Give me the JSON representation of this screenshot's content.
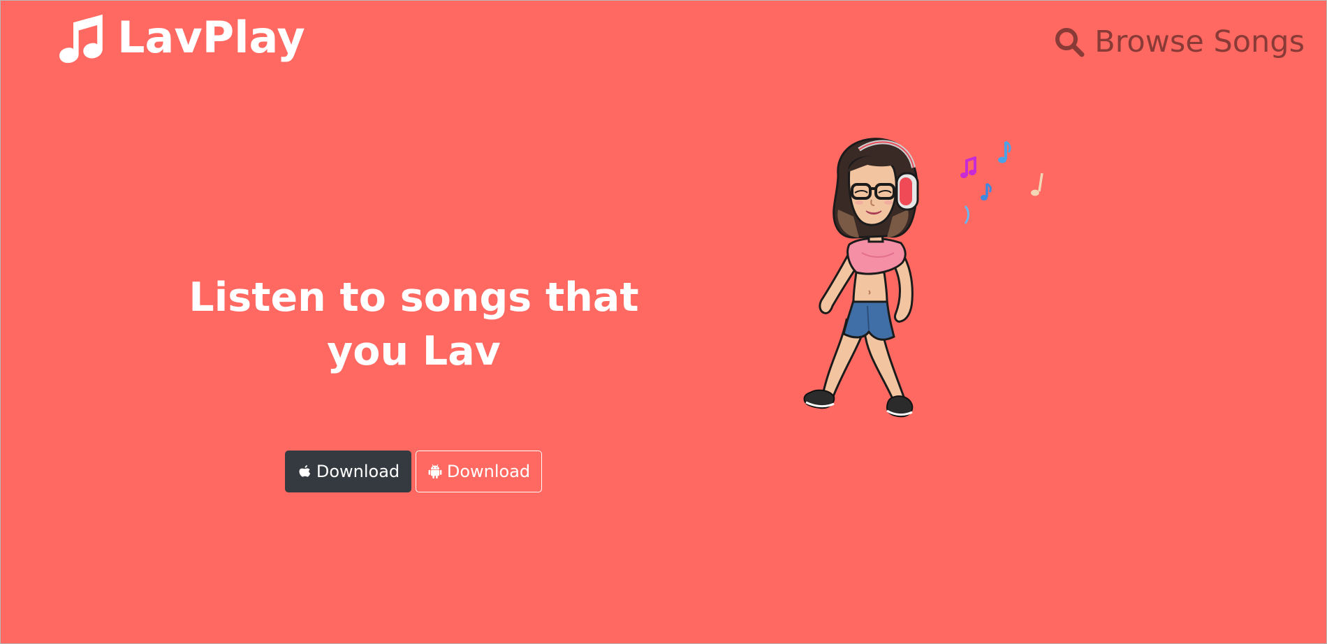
{
  "header": {
    "brand_name": "LavPlay",
    "brand_icon": "music-note-icon",
    "browse_label": "Browse Songs",
    "browse_icon": "search-icon"
  },
  "hero": {
    "headline": "Listen to songs that you Lav",
    "buttons": [
      {
        "label": "Download",
        "icon": "apple-icon",
        "style": "dark"
      },
      {
        "label": "Download",
        "icon": "android-icon",
        "style": "outline-light"
      }
    ],
    "illustration": "dancing-girl-with-headphones-illustration"
  },
  "colors": {
    "background": "#ff6961",
    "brand_text": "#ffffff",
    "browse_text": "#8a3b37",
    "dark_button": "#343a40"
  }
}
